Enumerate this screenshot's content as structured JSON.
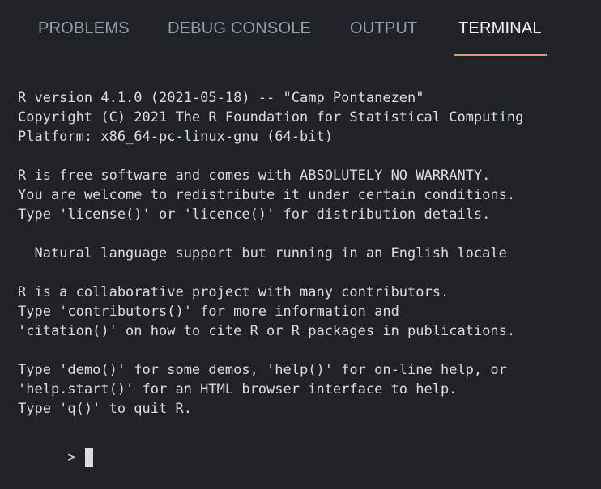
{
  "tabs": [
    {
      "label": "PROBLEMS",
      "active": false
    },
    {
      "label": "DEBUG CONSOLE",
      "active": false
    },
    {
      "label": "OUTPUT",
      "active": false
    },
    {
      "label": "TERMINAL",
      "active": true
    }
  ],
  "terminal": {
    "lines": [
      "R version 4.1.0 (2021-05-18) -- \"Camp Pontanezen\"",
      "Copyright (C) 2021 The R Foundation for Statistical Computing",
      "Platform: x86_64-pc-linux-gnu (64-bit)",
      "",
      "R is free software and comes with ABSOLUTELY NO WARRANTY.",
      "You are welcome to redistribute it under certain conditions.",
      "Type 'license()' or 'licence()' for distribution details.",
      "",
      "  Natural language support but running in an English locale",
      "",
      "R is a collaborative project with many contributors.",
      "Type 'contributors()' for more information and",
      "'citation()' on how to cite R or R packages in publications.",
      "",
      "Type 'demo()' for some demos, 'help()' for on-line help, or",
      "'help.start()' for an HTML browser interface to help.",
      "Type 'q()' to quit R."
    ],
    "prompt": ">"
  },
  "colors": {
    "background": "#1f2328",
    "tab_inactive": "#9a9fa8",
    "tab_active": "#f2f3f5",
    "tab_underline": "#e9907a",
    "terminal_text": "#d9dce1"
  }
}
